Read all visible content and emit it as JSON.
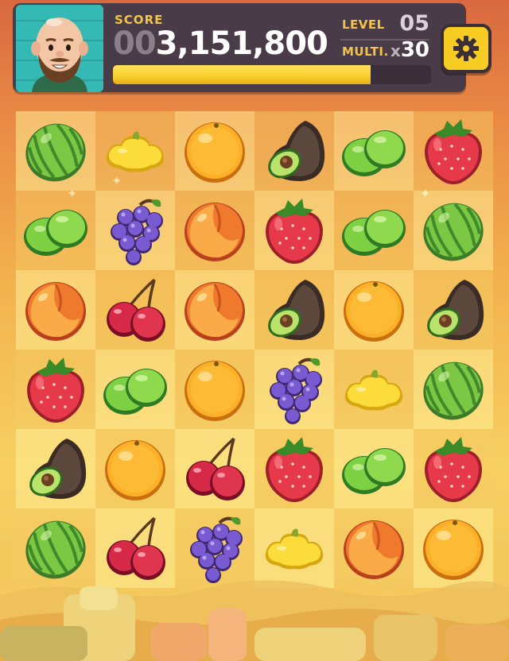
{
  "hud": {
    "score_label": "SCORE",
    "score_dim": "00",
    "score_main": "3,151,800",
    "level_label": "LEVEL",
    "level_value": "05",
    "multi_label": "MULTI.",
    "multi_prefix": "x",
    "multi_value": "30",
    "progress_fraction": 0.81,
    "settings_icon": "gear-icon",
    "avatar_icon": "bald-bearded-man-avatar"
  },
  "board": {
    "rows": 6,
    "cols": 6,
    "grid": [
      [
        "watermelon",
        "squash",
        "orange",
        "avocado",
        "lime",
        "strawberry"
      ],
      [
        "lime",
        "grapes",
        "peach",
        "strawberry",
        "lime",
        "watermelon"
      ],
      [
        "peach",
        "cherries",
        "peach",
        "avocado",
        "orange",
        "avocado"
      ],
      [
        "strawberry",
        "lime",
        "orange",
        "grapes",
        "squash",
        "watermelon"
      ],
      [
        "avocado",
        "orange",
        "cherries",
        "strawberry",
        "lime",
        "strawberry"
      ],
      [
        "watermelon",
        "cherries",
        "grapes",
        "squash",
        "peach",
        "orange"
      ]
    ]
  },
  "colors": {
    "hud_bg": "#4a3b48",
    "accent_yellow": "#f6c445",
    "progress_fill": "#f8cf2c",
    "avatar_bg": "#35b9b4"
  }
}
